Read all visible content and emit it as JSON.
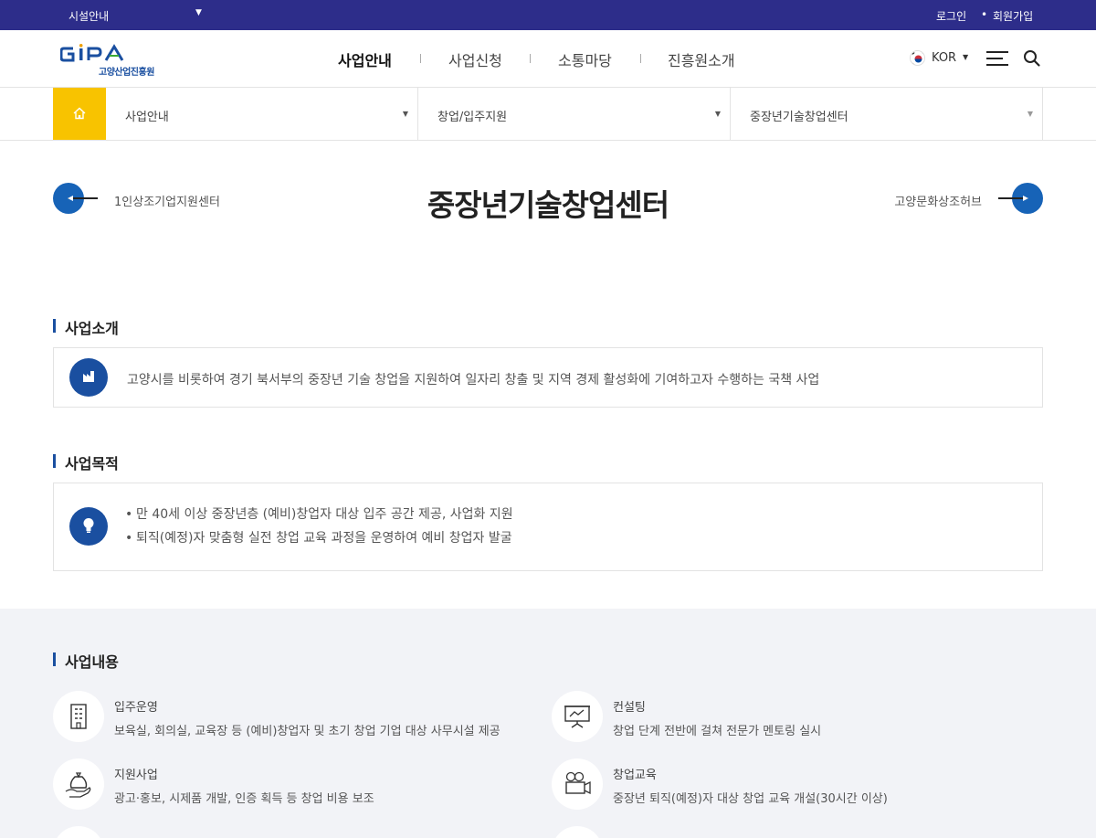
{
  "topbar": {
    "facility": "시설안내",
    "login": "로그인",
    "join": "회원가입"
  },
  "logo": {
    "mark": "GIPA",
    "sub": "고양산업진흥원"
  },
  "gnb": [
    "사업안내",
    "사업신청",
    "소통마당",
    "진흥원소개"
  ],
  "lang": "KOR",
  "breadcrumb": [
    "사업안내",
    "창업/입주지원",
    "중장년기술창업센터"
  ],
  "page": {
    "title": "중장년기술창업센터",
    "prev": "1인상조기업지원센터",
    "next": "고양문화상조허브"
  },
  "intro": {
    "title": "사업소개",
    "text": "고양시를 비롯하여 경기 북서부의 중장년 기술 창업을 지원하여 일자리 창출 및 지역 경제 활성화에 기여하고자 수행하는 국책 사업"
  },
  "purpose": {
    "title": "사업목적",
    "items": [
      "만 40세 이상 중장년층 (예비)창업자 대상 입주 공간 제공, 사업화 지원",
      "퇴직(예정)자 맞춤형 실전 창업 교육 과정을 운영하여 예비 창업자 발굴"
    ]
  },
  "contents": {
    "title": "사업내용",
    "items": [
      {
        "title": "입주운영",
        "text": "보육실, 회의실, 교육장 등 (예비)창업자 및 초기 창업 기업 대상 사무시설 제공",
        "icon": "building-icon"
      },
      {
        "title": "컨설팅",
        "text": "창업 단계 전반에 걸쳐 전문가 멘토링 실시",
        "icon": "presentation-board-icon"
      },
      {
        "title": "지원사업",
        "text": "광고·홍보, 시제품 개발, 인증 획득 등 창업 비용 보조",
        "icon": "money-bag-hand-icon"
      },
      {
        "title": "창업교육",
        "text": "중장년 퇴직(예정)자 대상 창업 교육 개설(30시간 이상)",
        "icon": "video-camera-icon"
      }
    ]
  },
  "colors": {
    "topbar": "#2d2d8a",
    "accent": "#1763b7",
    "home": "#f8c300"
  }
}
